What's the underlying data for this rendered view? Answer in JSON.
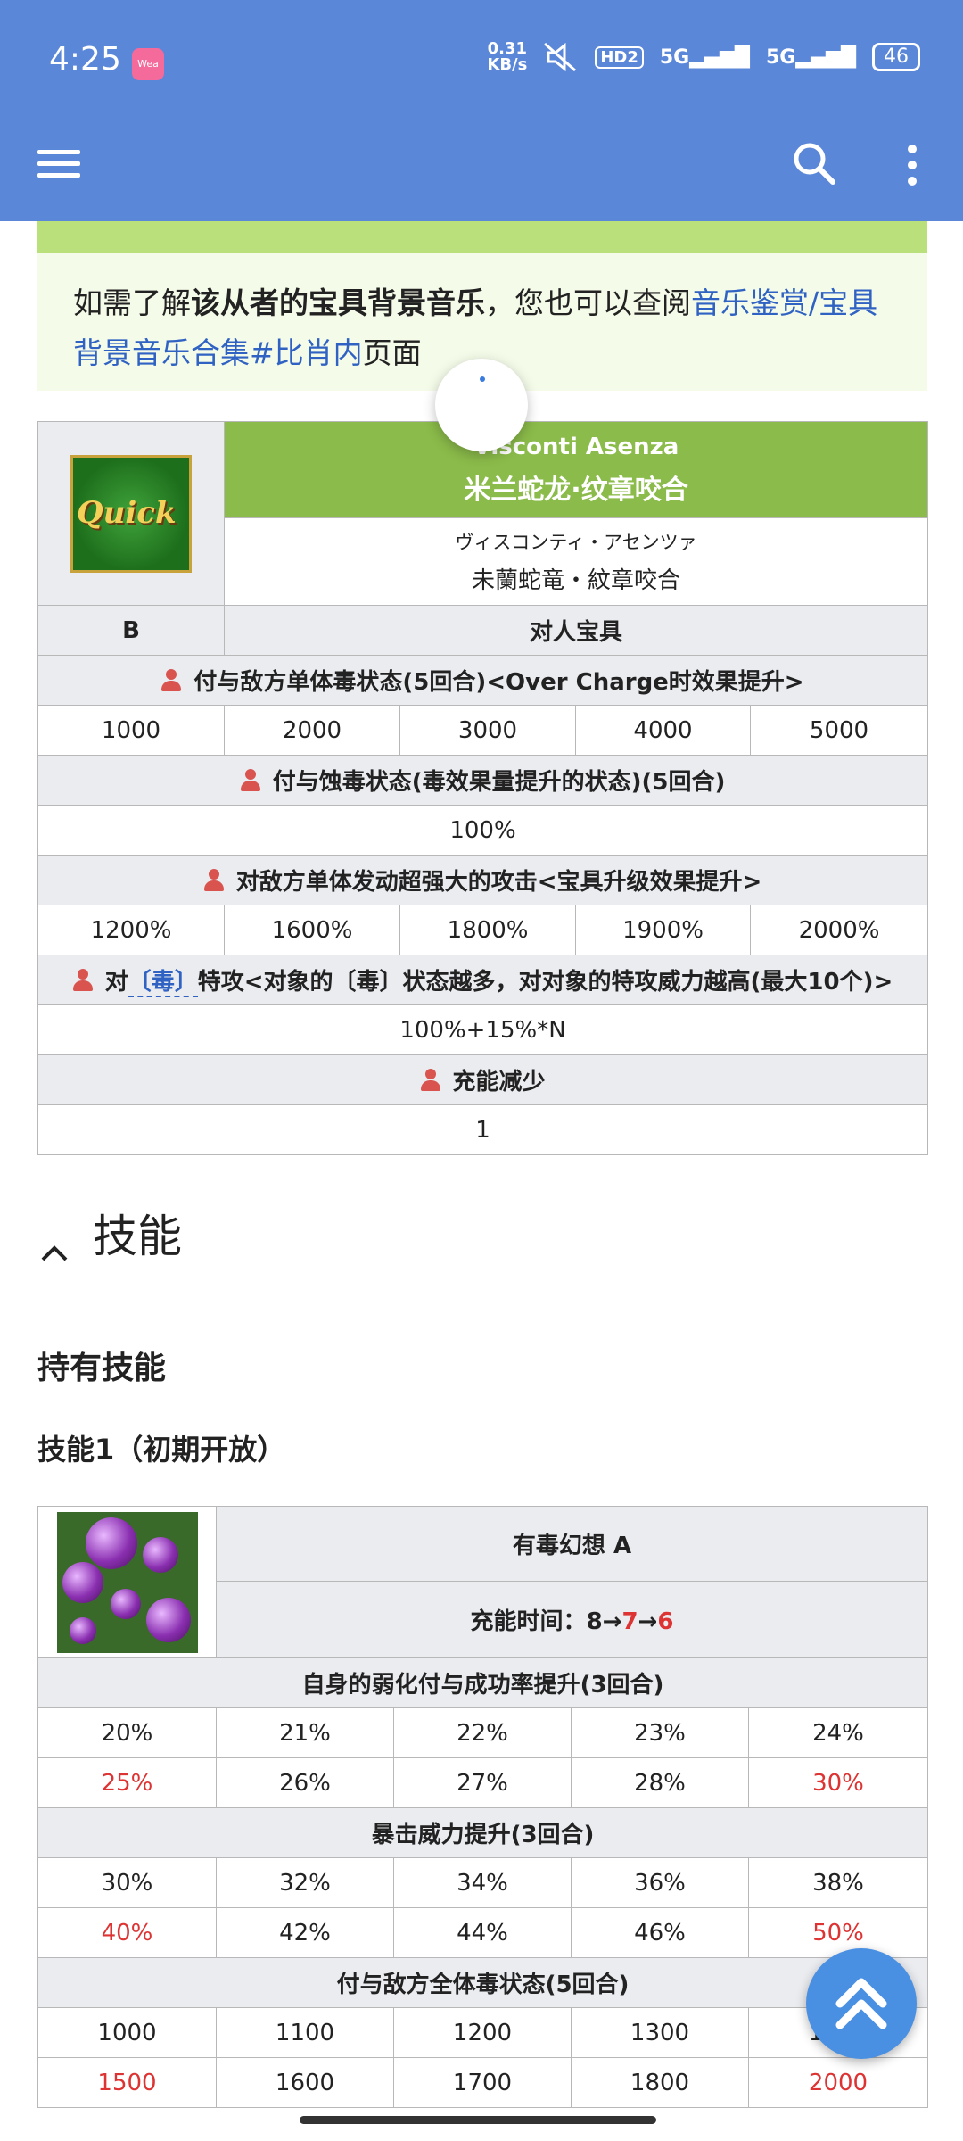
{
  "status": {
    "time": "4:25",
    "app_badge": "Wea",
    "net_speed_value": "0.31",
    "net_speed_unit": "KB/s",
    "hd": "HD2",
    "sig1": "5G",
    "sig2": "5G",
    "battery": "46"
  },
  "notice": {
    "pre": "如需了解",
    "bold": "该从者的宝具背景音乐",
    "mid": "，您也可以查阅",
    "link": "音乐鉴赏/宝具背景音乐合集#比肖内",
    "post": "页面"
  },
  "np": {
    "card": "Quick",
    "name_en": "Visconti Asenza",
    "name_cn": "米兰蛇龙·纹章咬合",
    "name_jp_reading": "ヴィスコンティ・アセンツァ",
    "name_jp": "未蘭蛇竜・紋章咬合",
    "rank": "B",
    "type": "对人宝具",
    "effect1": "付与敌方单体毒状态(5回合)<Over Charge时效果提升>",
    "effect1_values": [
      "1000",
      "2000",
      "3000",
      "4000",
      "5000"
    ],
    "effect2": "付与蚀毒状态(毒效果量提升的状态)(5回合)",
    "effect2_value": "100%",
    "effect3": "对敌方单体发动超强大的攻击<宝具升级效果提升>",
    "effect3_values": [
      "1200%",
      "1600%",
      "1800%",
      "1900%",
      "2000%"
    ],
    "effect4_pre": "对",
    "effect4_link": "〔毒〕",
    "effect4_post": "特攻<对象的〔毒〕状态越多，对对象的特攻威力越高(最大10个)>",
    "effect4_value": "100%+15%*N",
    "effect5": "充能减少",
    "effect5_value": "1"
  },
  "skills_section": {
    "title": "技能",
    "owned": "持有技能",
    "skill1_heading": "技能1（初期开放）"
  },
  "skill1": {
    "name": "有毒幻想 A",
    "cd_label": "充能时间：",
    "cd_start": "8→",
    "cd_mid": "7",
    "cd_arrow": "→",
    "cd_end": "6",
    "effect1": "自身的弱化付与成功率提升(3回合)",
    "effect1_row1": [
      "20%",
      "21%",
      "22%",
      "23%",
      "24%"
    ],
    "effect1_row2": [
      "25%",
      "26%",
      "27%",
      "28%",
      "30%"
    ],
    "effect2": "暴击威力提升(3回合)",
    "effect2_row1": [
      "30%",
      "32%",
      "34%",
      "36%",
      "38%"
    ],
    "effect2_row2": [
      "40%",
      "42%",
      "44%",
      "46%",
      "50%"
    ],
    "effect3": "付与敌方全体毒状态(5回合)",
    "effect3_row1": [
      "1000",
      "1100",
      "1200",
      "1300",
      "1400"
    ],
    "effect3_row2": [
      "1500",
      "1600",
      "1700",
      "1800",
      "2000"
    ]
  }
}
